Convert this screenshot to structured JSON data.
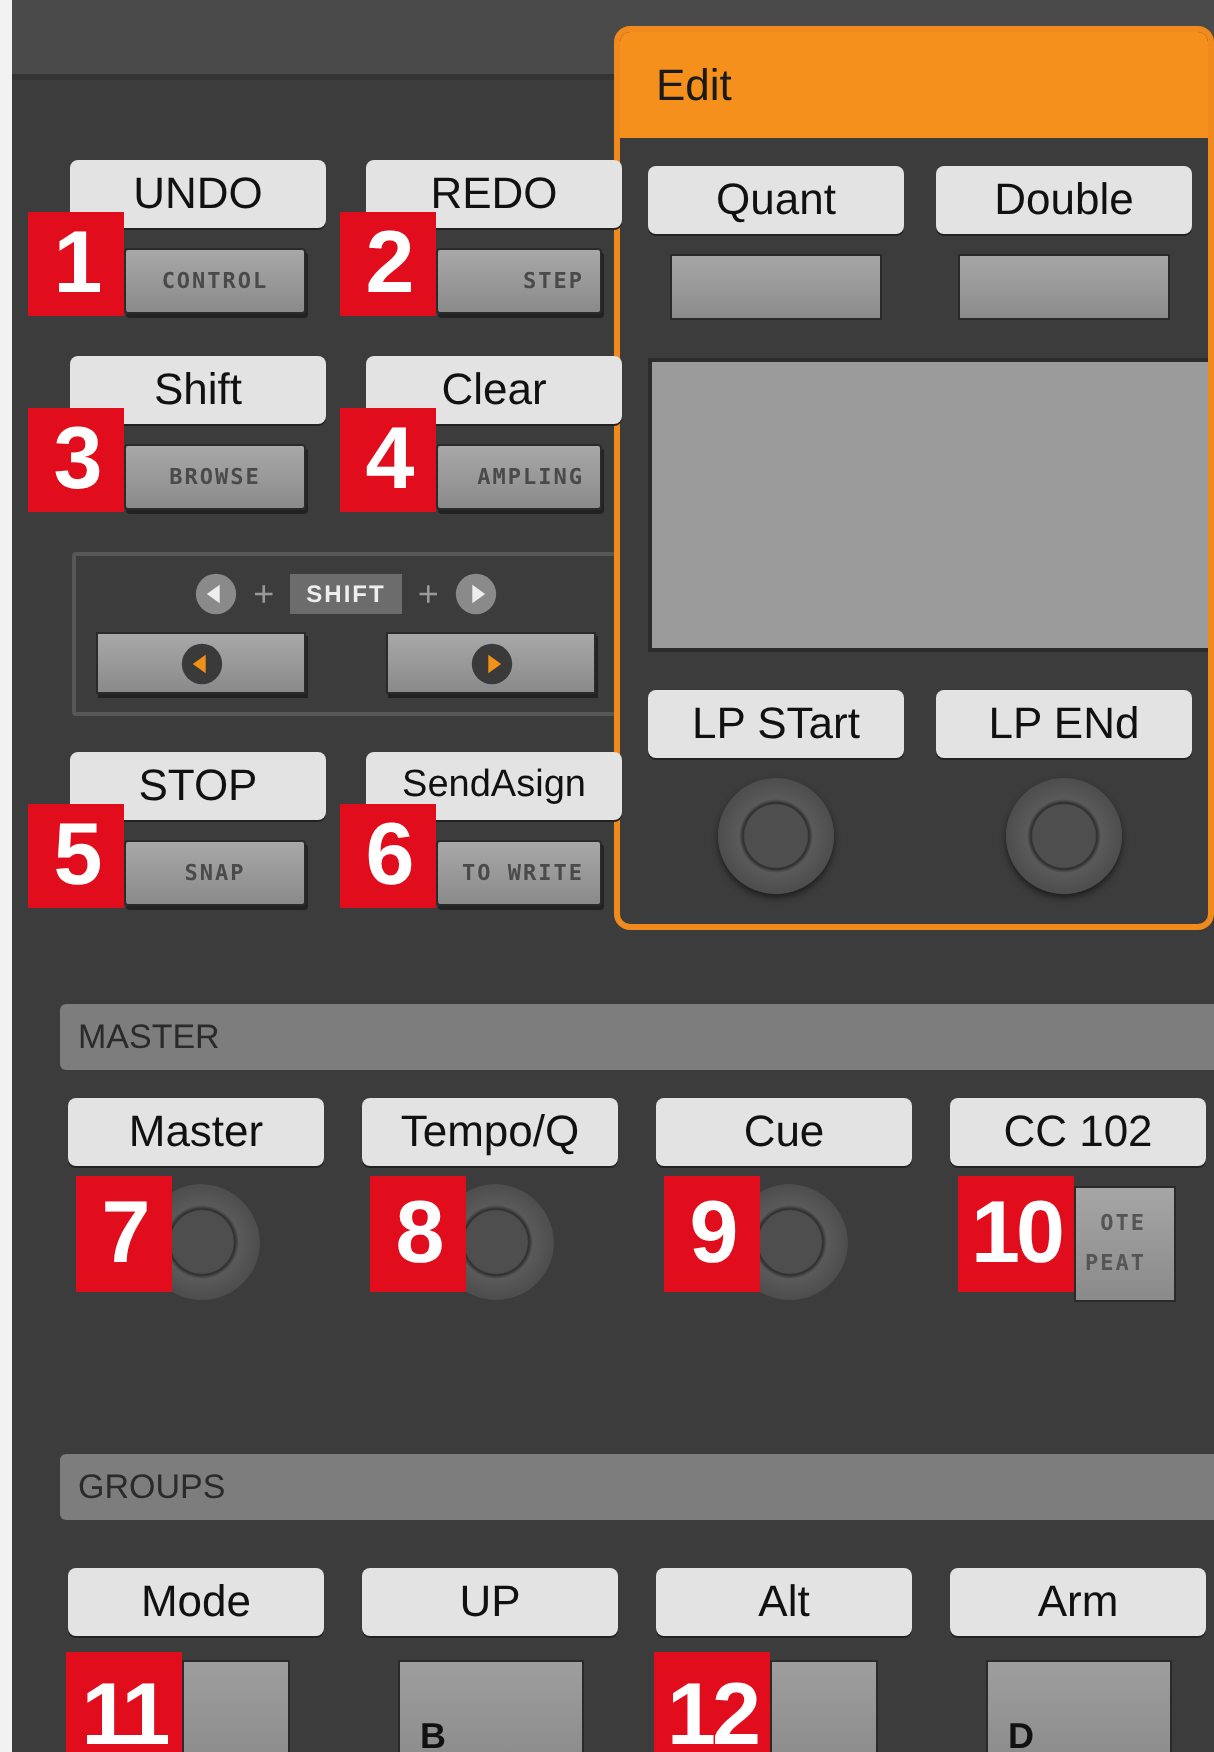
{
  "left_controls": [
    {
      "label": "UNDO",
      "button": "CONTROL",
      "badge": "1"
    },
    {
      "label": "REDO",
      "button": "STEP",
      "badge": "2"
    },
    {
      "label": "Shift",
      "button": "BROWSE",
      "badge": "3"
    },
    {
      "label": "Clear",
      "button": "AMPLING",
      "badge": "4"
    },
    {
      "label": "STOP",
      "button": "SNAP",
      "badge": "5"
    },
    {
      "label": "SendAsign",
      "button": "TO WRITE",
      "badge": "6"
    }
  ],
  "nav": {
    "plus_left": "+",
    "shift": "SHIFT",
    "plus_right": "+"
  },
  "edit_panel": {
    "title": "Edit",
    "buttons": [
      {
        "label": "Quant"
      },
      {
        "label": "Double"
      }
    ],
    "knobs": [
      {
        "label": "LP STart"
      },
      {
        "label": "LP ENd"
      }
    ]
  },
  "master": {
    "title": "MASTER",
    "controls": [
      {
        "label": "Master",
        "kind": "knob",
        "badge": "7"
      },
      {
        "label": "Tempo/Q",
        "kind": "knob",
        "badge": "8"
      },
      {
        "label": "Cue",
        "kind": "knob",
        "badge": "9"
      },
      {
        "label": "CC 102",
        "kind": "button",
        "button_lines": [
          "OTE",
          "PEAT"
        ],
        "badge": "10"
      }
    ]
  },
  "groups": {
    "title": "GROUPS",
    "controls": [
      {
        "label": "Mode",
        "badge": "11"
      },
      {
        "label": "UP",
        "pad": "B"
      },
      {
        "label": "Alt",
        "badge": "12"
      },
      {
        "label": "Arm",
        "pad": "D"
      }
    ]
  }
}
